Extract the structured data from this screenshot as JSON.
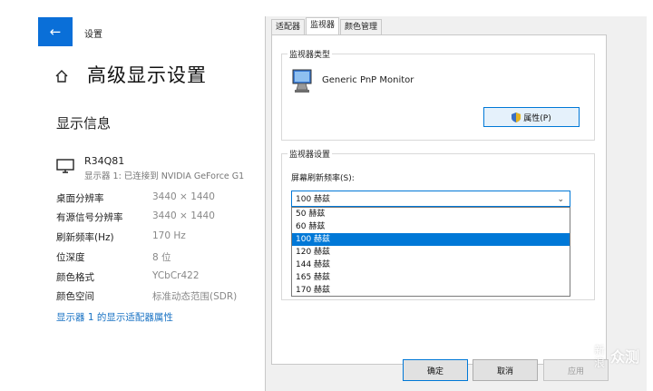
{
  "settings": {
    "app_title": "设置",
    "page_title": "高级显示设置",
    "section_title": "显示信息",
    "monitor_name": "R34Q81",
    "monitor_sub": "显示器 1: 已连接到 NVIDIA GeForce G1",
    "info": [
      {
        "label": "桌面分辨率",
        "value": "3440 × 1440"
      },
      {
        "label": "有源信号分辨率",
        "value": "3440 × 1440"
      },
      {
        "label": "刷新频率(Hz)",
        "value": "170 Hz"
      },
      {
        "label": "位深度",
        "value": "8 位"
      },
      {
        "label": "颜色格式",
        "value": "YCbCr422"
      },
      {
        "label": "颜色空间",
        "value": "标准动态范围(SDR)"
      }
    ],
    "adapter_link": "显示器 1 的显示适配器属性",
    "accent": "#0a6fd8"
  },
  "dialog": {
    "tabs": [
      "适配器",
      "监视器",
      "颜色管理"
    ],
    "active_tab": 1,
    "monitor_type_label": "监视器类型",
    "monitor_model": "Generic PnP Monitor",
    "properties_button": "属性(P)",
    "monitor_settings_label": "监视器设置",
    "refresh_rate_label": "屏幕刷新频率(S):",
    "selected_rate": "100 赫兹",
    "options": [
      "50 赫兹",
      "60 赫兹",
      "100 赫兹",
      "120 赫兹",
      "144 赫兹",
      "165 赫兹",
      "170 赫兹"
    ],
    "selected_index": 2,
    "ok_button": "确定",
    "cancel_button": "取消",
    "apply_button": "应用",
    "select_color": "#0078d7"
  },
  "watermark": {
    "line1": "新",
    "line2": "浪",
    "brand": "众测"
  }
}
